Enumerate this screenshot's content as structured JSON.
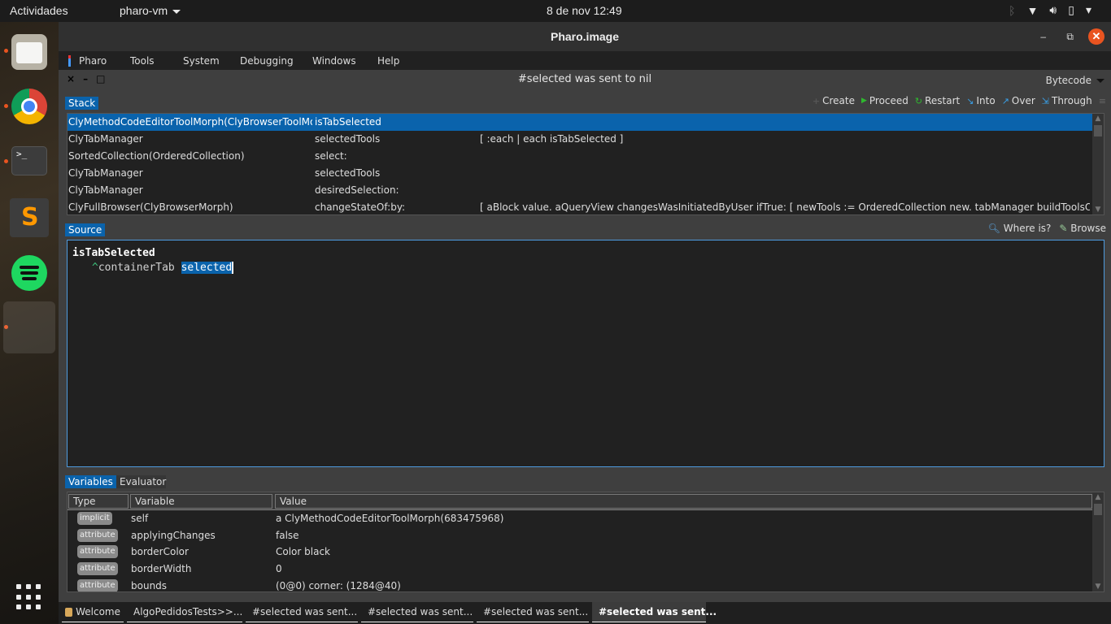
{
  "topbar": {
    "activities": "Actividades",
    "app_menu": "pharo-vm",
    "clock": "8 de nov  12:49",
    "tray_icons": [
      "bluetooth-icon",
      "wifi-icon",
      "volume-icon",
      "battery-icon",
      "system-menu-caret"
    ]
  },
  "dock": {
    "items": [
      "files",
      "chrome",
      "terminal",
      "sublime-text",
      "spotify",
      "pharo"
    ],
    "terminal_prompt": ">_"
  },
  "window": {
    "title": "Pharo.image",
    "controls": {
      "minimize": "–",
      "maximize": "⧉",
      "close": "✕"
    }
  },
  "menubar": {
    "items": [
      "Pharo",
      "Tools",
      "System",
      "Debugging",
      "Windows",
      "Help"
    ]
  },
  "debugger": {
    "title": "#selected was sent to nil",
    "window_controls": [
      "×",
      "–",
      "□"
    ],
    "view_selector": "Bytecode",
    "stack_tab": "Stack",
    "toolbar": [
      {
        "icon": "create-icon",
        "label": "Create"
      },
      {
        "icon": "proceed-icon",
        "label": "Proceed"
      },
      {
        "icon": "restart-icon",
        "label": "Restart"
      },
      {
        "icon": "into-icon",
        "label": "Into"
      },
      {
        "icon": "over-icon",
        "label": "Over"
      },
      {
        "icon": "through-icon",
        "label": "Through"
      }
    ],
    "stack": [
      {
        "receiver": "ClyMethodCodeEditorToolMorph(ClyBrowserToolMorph)",
        "method": "isTabSelected",
        "block": "",
        "selected": true
      },
      {
        "receiver": "ClyTabManager",
        "method": "selectedTools",
        "block": "[ :each | each isTabSelected ]",
        "selected": false
      },
      {
        "receiver": "SortedCollection(OrderedCollection)",
        "method": "select:",
        "block": "",
        "selected": false
      },
      {
        "receiver": "ClyTabManager",
        "method": "selectedTools",
        "block": "",
        "selected": false
      },
      {
        "receiver": "ClyTabManager",
        "method": "desiredSelection:",
        "block": "",
        "selected": false
      },
      {
        "receiver": "ClyFullBrowser(ClyBrowserMorph)",
        "method": "changeStateOf:by:",
        "block": "[ aBlock value. aQueryView changesWasInitiatedByUser  ifTrue: [ newTools := OrderedCollection new.   tabManager    buildToolsOn: newTools",
        "selected": false
      }
    ],
    "source_tab": "Source",
    "source_toolbar": [
      {
        "icon": "where-is-icon",
        "label": "Where is?"
      },
      {
        "icon": "browse-icon",
        "label": "Browse"
      }
    ],
    "source": {
      "method_name": "isTabSelected",
      "return_symbol": "^",
      "body_prefix": "containerTab ",
      "selection": "selected"
    },
    "bottom_tabs": [
      {
        "label": "Variables",
        "active": true
      },
      {
        "label": "Evaluator",
        "active": false
      }
    ],
    "variables_headers": [
      "Type",
      "Variable",
      "Value"
    ],
    "variables": [
      {
        "type": "implicit",
        "name": "self",
        "value": "a ClyMethodCodeEditorToolMorph(683475968)"
      },
      {
        "type": "attribute",
        "name": "applyingChanges",
        "value": "false"
      },
      {
        "type": "attribute",
        "name": "borderColor",
        "value": "Color black"
      },
      {
        "type": "attribute",
        "name": "borderWidth",
        "value": "0"
      },
      {
        "type": "attribute",
        "name": "bounds",
        "value": "(0@0) corner: (1284@40)"
      }
    ]
  },
  "taskbar": [
    {
      "icon": "welcome-icon",
      "label": "Welcome",
      "active": false
    },
    {
      "icon": "browser-icon",
      "label": "AlgoPedidosTests>>...",
      "active": false
    },
    {
      "icon": "debugger-bug-icon",
      "label": "#selected was sent...",
      "active": false
    },
    {
      "icon": "debugger-bug-icon",
      "label": "#selected was sent...",
      "active": false
    },
    {
      "icon": "debugger-bug-icon",
      "label": "#selected was sent...",
      "active": false
    },
    {
      "icon": "debugger-bug-icon",
      "label": "#selected was sent...",
      "active": true
    }
  ]
}
